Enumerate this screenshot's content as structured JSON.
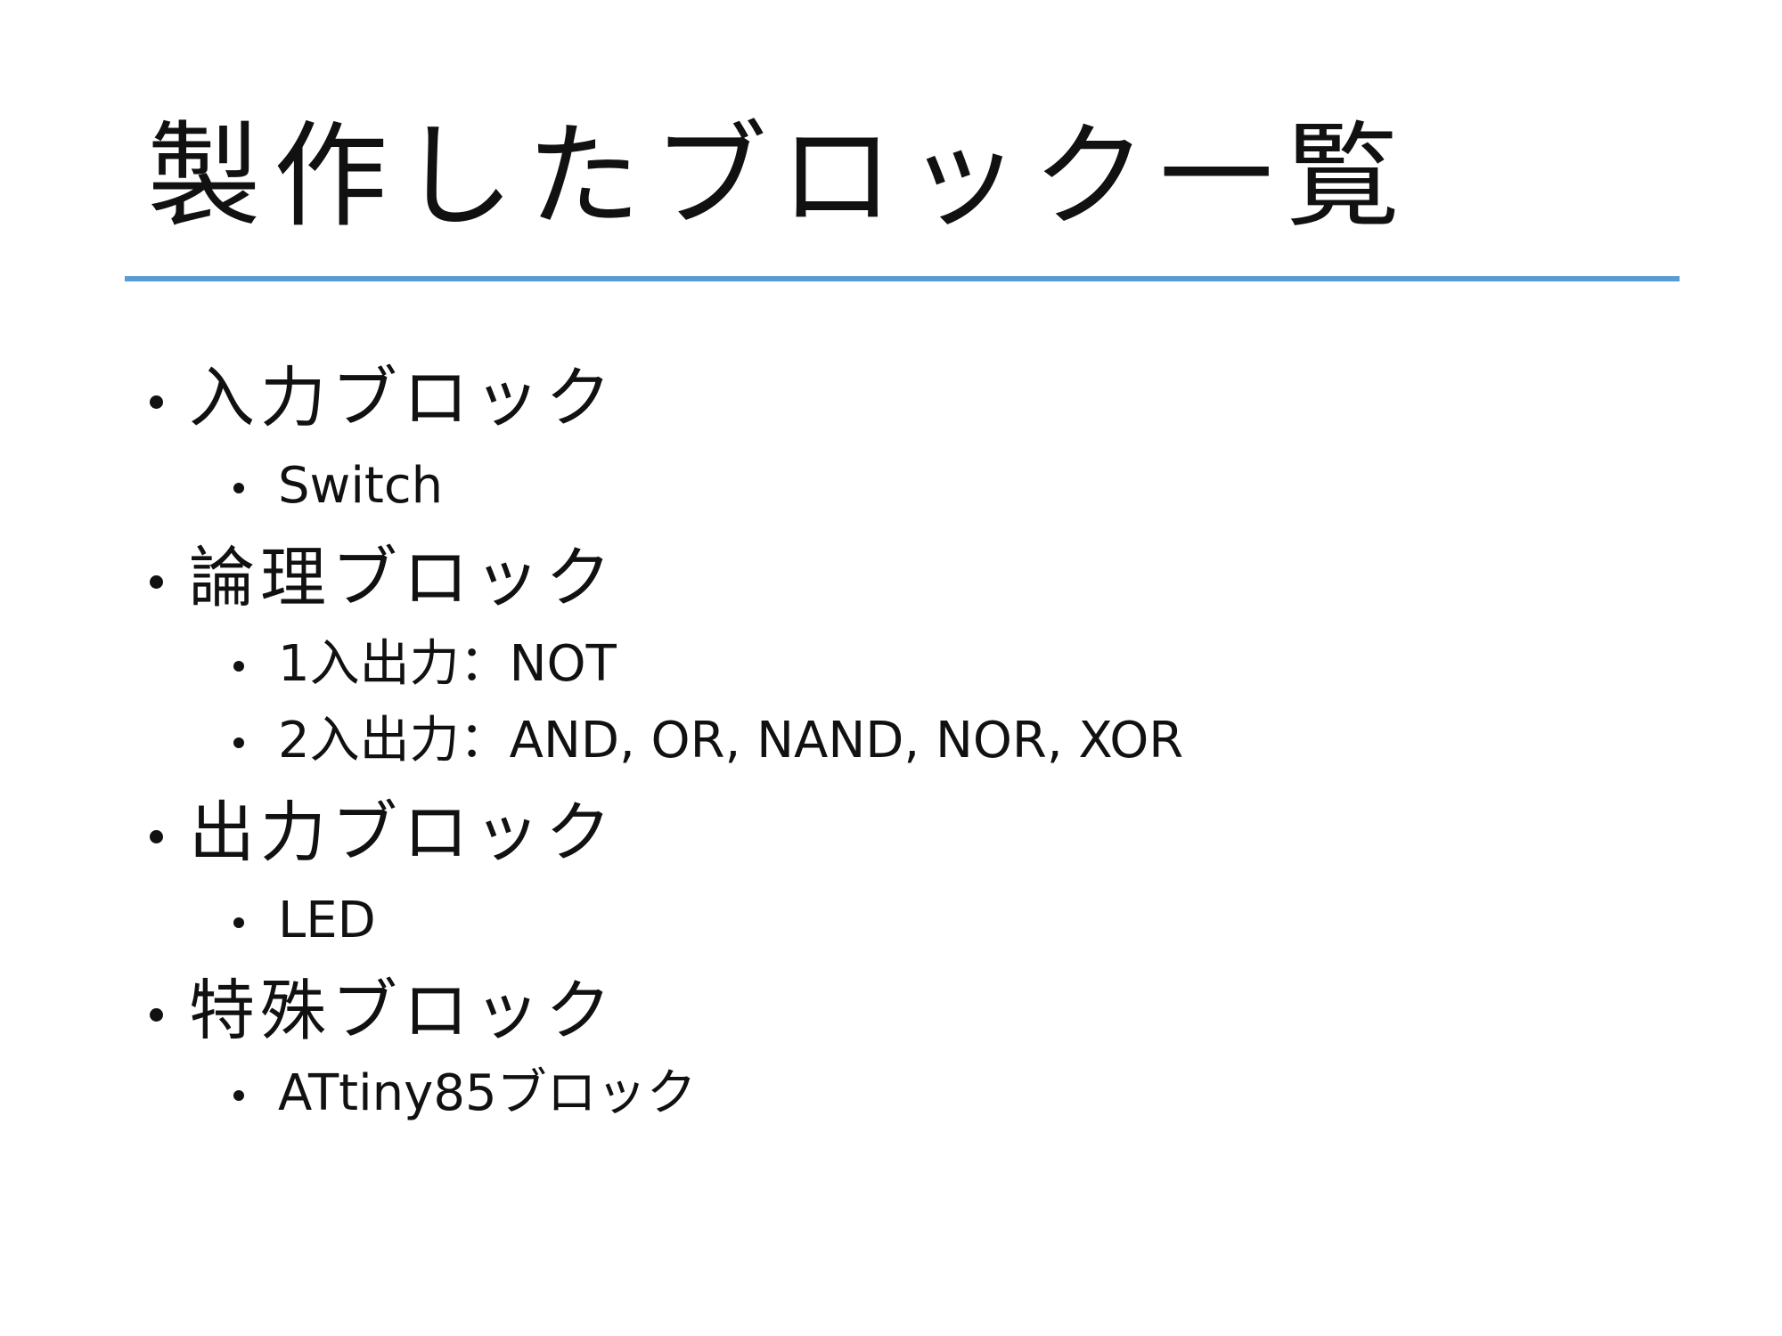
{
  "slide": {
    "title": "製作したブロック一覧",
    "accent_color": "#5b9bd5",
    "items": [
      {
        "label": "入力ブロック",
        "children": [
          "Switch"
        ]
      },
      {
        "label": "論理ブロック",
        "children": [
          "1入出力：NOT",
          "2入出力：AND, OR, NAND, NOR, XOR"
        ]
      },
      {
        "label": "出力ブロック",
        "children": [
          "LED"
        ]
      },
      {
        "label": "特殊ブロック",
        "children": [
          "ATtiny85ブロック"
        ]
      }
    ]
  }
}
